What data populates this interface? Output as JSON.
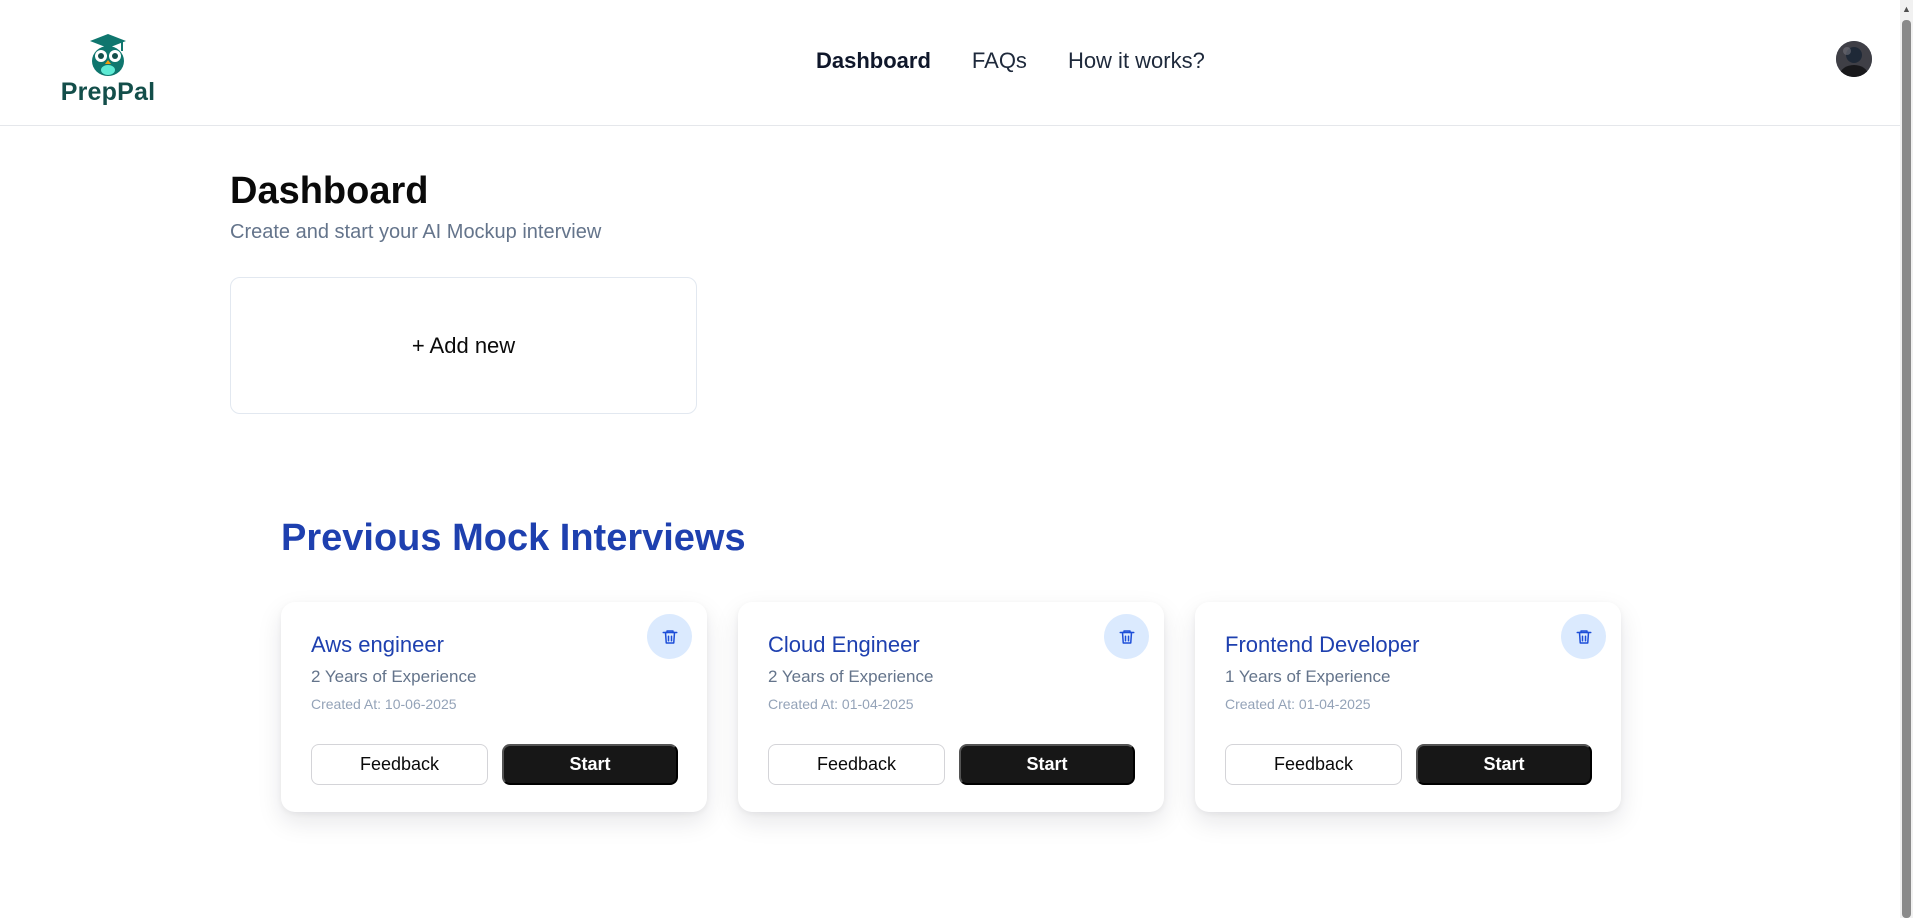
{
  "header": {
    "logo_text": "PrepPal",
    "nav": [
      {
        "label": "Dashboard",
        "active": true
      },
      {
        "label": "FAQs",
        "active": false
      },
      {
        "label": "How it works?",
        "active": false
      }
    ]
  },
  "main": {
    "title": "Dashboard",
    "subtitle": "Create and start your AI Mockup interview",
    "add_new_label": "+ Add new",
    "previous_title": "Previous Mock Interviews",
    "interviews": [
      {
        "title": "Aws engineer",
        "experience": "2 Years of Experience",
        "created": "Created At: 10-06-2025",
        "feedback_label": "Feedback",
        "start_label": "Start"
      },
      {
        "title": "Cloud Engineer",
        "experience": "2 Years of Experience",
        "created": "Created At: 01-04-2025",
        "feedback_label": "Feedback",
        "start_label": "Start"
      },
      {
        "title": "Frontend Developer",
        "experience": "1 Years of Experience",
        "created": "Created At: 01-04-2025",
        "feedback_label": "Feedback",
        "start_label": "Start"
      }
    ]
  },
  "icons": {
    "logo": "owl-graduation-cap-icon",
    "delete": "trash-icon",
    "avatar": "user-avatar"
  },
  "colors": {
    "accent": "#1e40af",
    "logo": "#134e4a",
    "start_button": "#171717",
    "delete_bg": "#dbeafe"
  }
}
